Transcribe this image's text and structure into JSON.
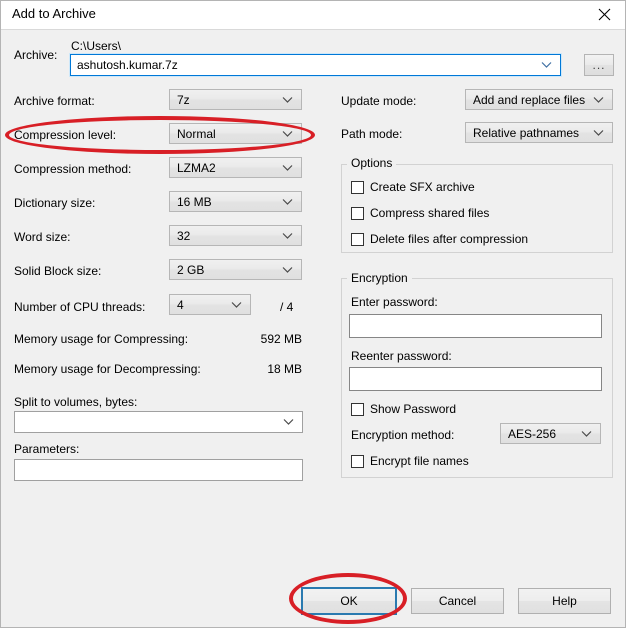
{
  "window": {
    "title": "Add to Archive",
    "close_icon": "close-icon"
  },
  "archive": {
    "label": "Archive:",
    "path_text": "C:\\Users\\",
    "name_value": "ashutosh.kumar.7z",
    "browse_label": "...",
    "dropdown_icon": "chevron-down-icon"
  },
  "left_column": {
    "archive_format": {
      "label": "Archive format:",
      "value": "7z"
    },
    "compression_level": {
      "label": "Compression level:",
      "value": "Normal"
    },
    "compression_method": {
      "label": "Compression method:",
      "value": "LZMA2"
    },
    "dictionary_size": {
      "label": "Dictionary size:",
      "value": "16 MB"
    },
    "word_size": {
      "label": "Word size:",
      "value": "32"
    },
    "solid_block_size": {
      "label": "Solid Block size:",
      "value": "2 GB"
    },
    "cpu_threads": {
      "label": "Number of CPU threads:",
      "value": "4",
      "max_text": "/ 4"
    },
    "memory_compressing": {
      "label": "Memory usage for Compressing:",
      "value": "592 MB"
    },
    "memory_decompressing": {
      "label": "Memory usage for Decompressing:",
      "value": "18 MB"
    },
    "split_volumes": {
      "label": "Split to volumes, bytes:",
      "value": ""
    },
    "parameters": {
      "label": "Parameters:",
      "value": ""
    }
  },
  "right_column": {
    "update_mode": {
      "label": "Update mode:",
      "value": "Add and replace files"
    },
    "path_mode": {
      "label": "Path mode:",
      "value": "Relative pathnames"
    },
    "options": {
      "title": "Options",
      "items": [
        {
          "label": "Create SFX archive",
          "checked": false
        },
        {
          "label": "Compress shared files",
          "checked": false
        },
        {
          "label": "Delete files after compression",
          "checked": false
        }
      ]
    },
    "encryption": {
      "title": "Encryption",
      "enter_password_label": "Enter password:",
      "enter_password_value": "",
      "reenter_password_label": "Reenter password:",
      "reenter_password_value": "",
      "show_password": {
        "label": "Show Password",
        "checked": false
      },
      "method_label": "Encryption method:",
      "method_value": "AES-256",
      "encrypt_names": {
        "label": "Encrypt file names",
        "checked": false
      }
    }
  },
  "buttons": {
    "ok": "OK",
    "cancel": "Cancel",
    "help": "Help"
  },
  "annotations": {
    "color": "#d81f26",
    "highlight_compression_level": "compression-level-row",
    "highlight_ok": "ok-button"
  }
}
